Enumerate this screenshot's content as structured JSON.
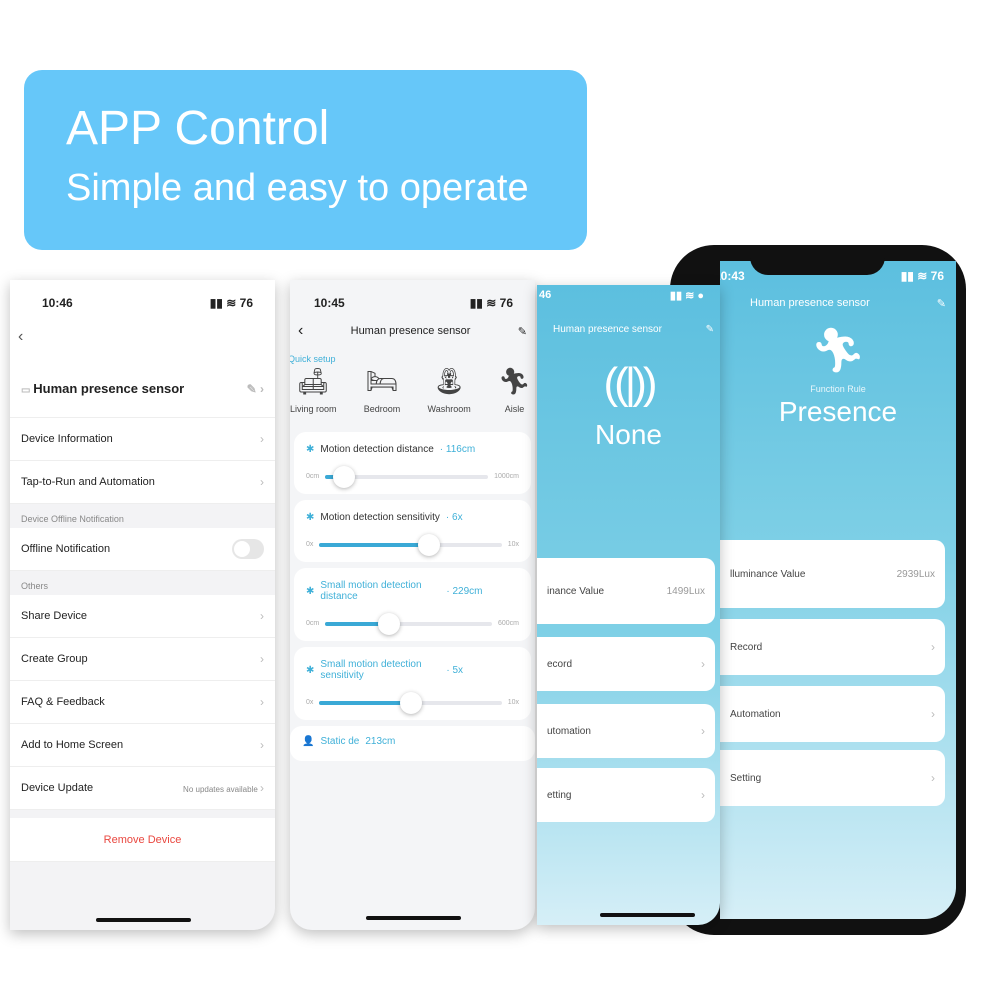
{
  "banner": {
    "title": "APP Control",
    "subtitle": "Simple and easy to operate"
  },
  "screen1": {
    "time": "10:46",
    "battery": "76",
    "device_name": "Human presence sensor",
    "items": [
      {
        "label": "Device Information"
      },
      {
        "label": "Tap-to-Run and Automation"
      }
    ],
    "section_offline": "Device Offline Notification",
    "offline_label": "Offline Notification",
    "offline_enabled": false,
    "section_others": "Others",
    "others": [
      {
        "label": "Share Device"
      },
      {
        "label": "Create Group"
      },
      {
        "label": "FAQ & Feedback"
      },
      {
        "label": "Add to Home Screen"
      }
    ],
    "update_label": "Device Update",
    "update_status": "No updates available",
    "remove": "Remove Device"
  },
  "screen2": {
    "time": "10:45",
    "battery": "76",
    "title": "Human presence sensor",
    "quick_setup": "Quick setup",
    "scenes": [
      {
        "label": "Living room",
        "icon": "sofa-icon"
      },
      {
        "label": "Bedroom",
        "icon": "bed-icon"
      },
      {
        "label": "Washroom",
        "icon": "sink-icon"
      },
      {
        "label": "Aisle",
        "icon": "running-person-icon"
      }
    ],
    "sliders": [
      {
        "title": "Motion detection distance",
        "value": "116cm",
        "min": "0cm",
        "max": "1000cm",
        "fraction": 0.116,
        "accent": false
      },
      {
        "title": "Motion detection sensitivity",
        "value": "6x",
        "min": "0x",
        "max": "10x",
        "fraction": 0.6,
        "accent": false
      },
      {
        "title": "Small motion detection distance",
        "value": "229cm",
        "min": "0cm",
        "max": "600cm",
        "fraction": 0.38,
        "accent": true
      },
      {
        "title": "Small motion detection sensitivity",
        "value": "5x",
        "min": "0x",
        "max": "10x",
        "fraction": 0.5,
        "accent": true
      }
    ],
    "static_label": "Static de",
    "static_value": "213cm"
  },
  "screen3": {
    "time": "46",
    "title": "Human presence sensor",
    "state": "None",
    "illum_label": "inance Value",
    "illum_value": "1499Lux",
    "record": "ecord",
    "automation": "utomation",
    "setting": "etting"
  },
  "screen4": {
    "time": "10:43",
    "battery": "76",
    "title": "Human presence sensor",
    "rule_label": "Function Rule",
    "state": "Presence",
    "illum_label": "lluminance Value",
    "illum_value": "2939Lux",
    "record": "Record",
    "automation": "Automation",
    "setting": "Setting"
  },
  "colors": {
    "banner": "#66c7f9",
    "accent": "#3fb0d8",
    "remove": "#e9473f"
  }
}
